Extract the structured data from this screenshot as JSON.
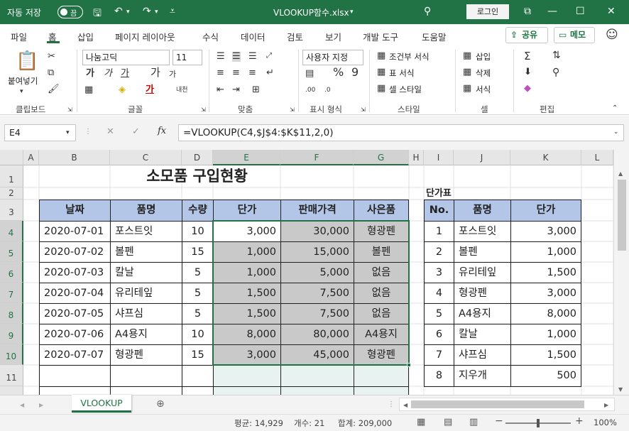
{
  "titlebar": {
    "autosave_label": "자동 저장",
    "autosave_state": "끔",
    "filename": "VLOOKUP함수.xlsx",
    "login_label": "로그인"
  },
  "ribbon_tabs": [
    "파일",
    "홈",
    "삽입",
    "페이지 레이아웃",
    "수식",
    "데이터",
    "검토",
    "보기",
    "개발 도구",
    "도움말"
  ],
  "ribbon_actions": {
    "share": "공유",
    "memo": "메모"
  },
  "ribbon": {
    "paste": "붙여넣기",
    "font_name": "나눔고딕",
    "font_size": "11",
    "number_format": "사용자 지정",
    "conditional": "조건부 서식",
    "table_format": "표 서식",
    "cell_style": "셀 스타일",
    "insert": "삽입",
    "delete": "삭제",
    "format": "서식",
    "groups": [
      "클립보드",
      "글꼴",
      "맞춤",
      "표시 형식",
      "스타일",
      "셀",
      "편집"
    ]
  },
  "formula_bar": {
    "name_box": "E4",
    "formula": "=VLOOKUP(C4,$J$4:$K$11,2,0)"
  },
  "columns": [
    "A",
    "B",
    "C",
    "D",
    "E",
    "F",
    "G",
    "H",
    "I",
    "J",
    "K",
    "L"
  ],
  "rows": [
    "1",
    "2",
    "3",
    "4",
    "5",
    "6",
    "7",
    "8",
    "9",
    "10",
    "11"
  ],
  "sheet": {
    "title": "소모품 구입현황",
    "headers": [
      "날짜",
      "품명",
      "수량",
      "단가",
      "판매가격",
      "사은품"
    ],
    "data": [
      [
        "2020-07-01",
        "포스트잇",
        "10",
        "3,000",
        "30,000",
        "형광펜"
      ],
      [
        "2020-07-02",
        "볼펜",
        "15",
        "1,000",
        "15,000",
        "볼펜"
      ],
      [
        "2020-07-03",
        "칼날",
        "5",
        "1,000",
        "5,000",
        "없음"
      ],
      [
        "2020-07-04",
        "유리테잎",
        "5",
        "1,500",
        "7,500",
        "없음"
      ],
      [
        "2020-07-05",
        "샤프심",
        "5",
        "1,500",
        "7,500",
        "없음"
      ],
      [
        "2020-07-06",
        "A4용지",
        "10",
        "8,000",
        "80,000",
        "A4용지"
      ],
      [
        "2020-07-07",
        "형광펜",
        "15",
        "3,000",
        "45,000",
        "형광펜"
      ]
    ],
    "lookup_title": "단가표",
    "lookup_headers": [
      "No.",
      "품명",
      "단가"
    ],
    "lookup_data": [
      [
        "1",
        "포스트잇",
        "3,000"
      ],
      [
        "2",
        "볼펜",
        "1,000"
      ],
      [
        "3",
        "유리테잎",
        "1,500"
      ],
      [
        "4",
        "형광펜",
        "3,000"
      ],
      [
        "5",
        "A4용지",
        "8,000"
      ],
      [
        "6",
        "칼날",
        "1,000"
      ],
      [
        "7",
        "샤프심",
        "1,500"
      ],
      [
        "8",
        "지우개",
        "500"
      ]
    ]
  },
  "sheet_tab": "VLOOKUP",
  "status": {
    "average": "평균: 14,929",
    "count": "개수: 21",
    "sum": "합계: 209,000",
    "zoom": "100%"
  },
  "colors": {
    "accent": "#217346",
    "header_fill": "#b4c6e7",
    "selection": "#c9c9c9"
  }
}
